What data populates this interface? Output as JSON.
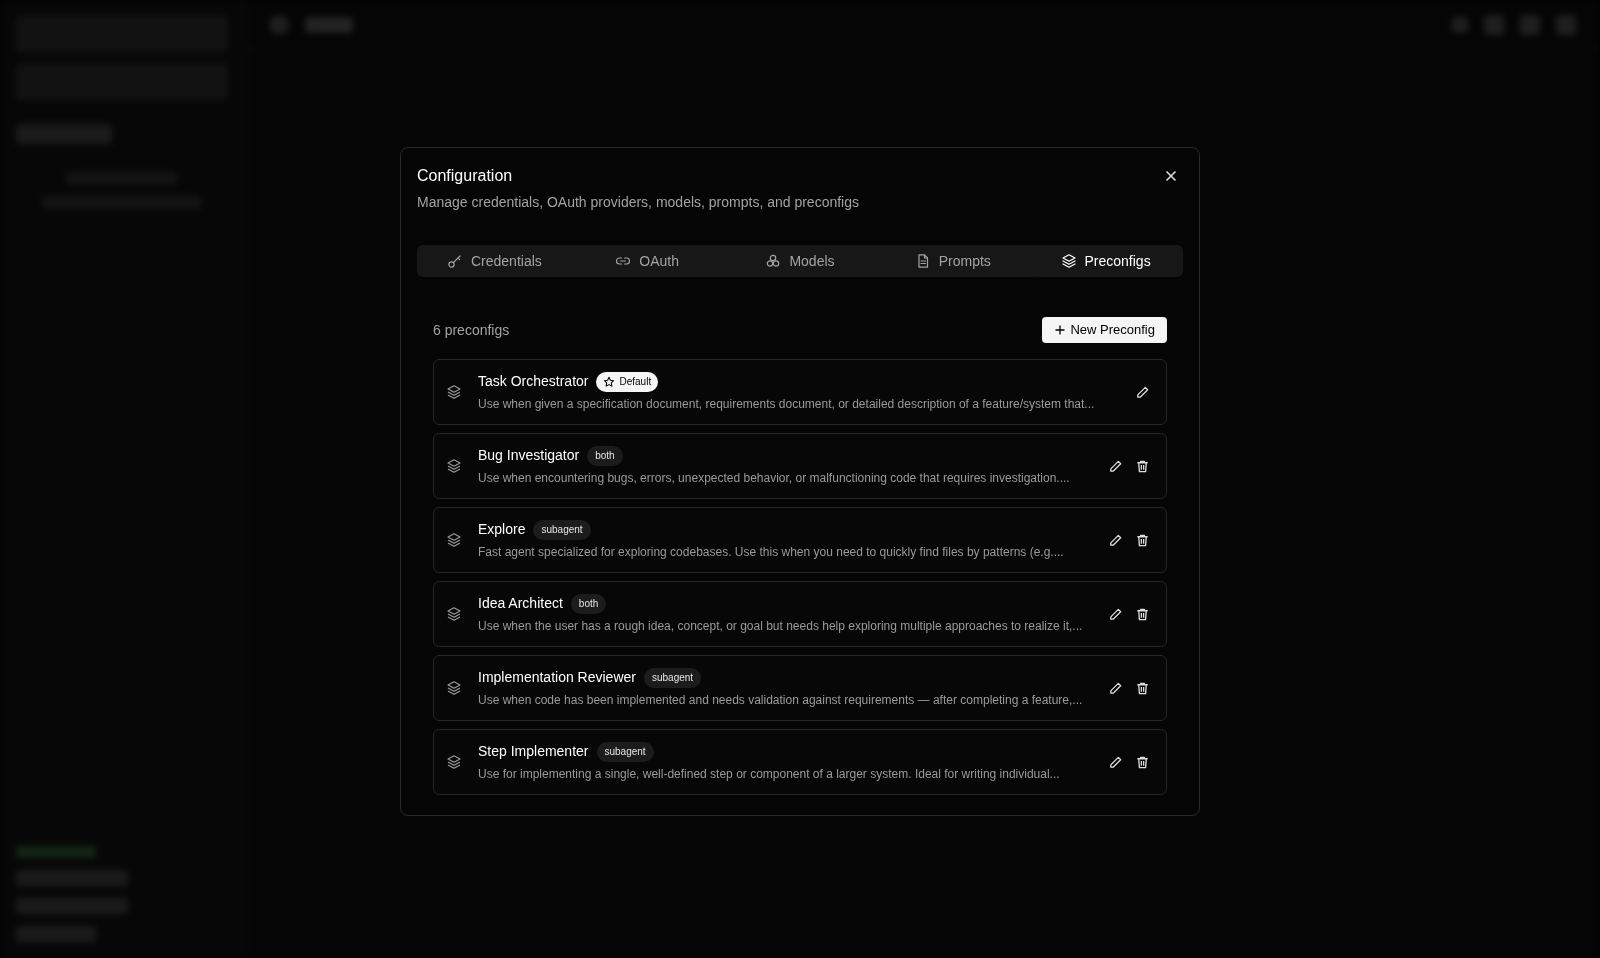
{
  "dialog": {
    "title": "Configuration",
    "subtitle": "Manage credentials, OAuth providers, models, prompts, and preconfigs"
  },
  "tabs": [
    {
      "label": "Credentials",
      "selected": false
    },
    {
      "label": "OAuth",
      "selected": false
    },
    {
      "label": "Models",
      "selected": false
    },
    {
      "label": "Prompts",
      "selected": false
    },
    {
      "label": "Preconfigs",
      "selected": true
    }
  ],
  "count": "6 preconfigs",
  "new_button": "New Preconfig",
  "preconfigs": [
    {
      "name": "Task Orchestrator",
      "badge": {
        "kind": "default",
        "label": "Default"
      },
      "description": "Use when given a specification document, requirements document, or detailed description of a feature/system that...",
      "deletable": false
    },
    {
      "name": "Bug Investigator",
      "badge": {
        "kind": "tag",
        "label": "both"
      },
      "description": "Use when encountering bugs, errors, unexpected behavior, or malfunctioning code that requires investigation....",
      "deletable": true
    },
    {
      "name": "Explore",
      "badge": {
        "kind": "tag",
        "label": "subagent"
      },
      "description": "Fast agent specialized for exploring codebases. Use this when you need to quickly find files by patterns (e.g....",
      "deletable": true
    },
    {
      "name": "Idea Architect",
      "badge": {
        "kind": "tag",
        "label": "both"
      },
      "description": "Use when the user has a rough idea, concept, or goal but needs help exploring multiple approaches to realize it,...",
      "deletable": true
    },
    {
      "name": "Implementation Reviewer",
      "badge": {
        "kind": "tag",
        "label": "subagent"
      },
      "description": "Use when code has been implemented and needs validation against requirements — after completing a feature,...",
      "deletable": true
    },
    {
      "name": "Step Implementer",
      "badge": {
        "kind": "tag",
        "label": "subagent"
      },
      "description": "Use for implementing a single, well-defined step or component of a larger system. Ideal for writing individual...",
      "deletable": true
    }
  ]
}
